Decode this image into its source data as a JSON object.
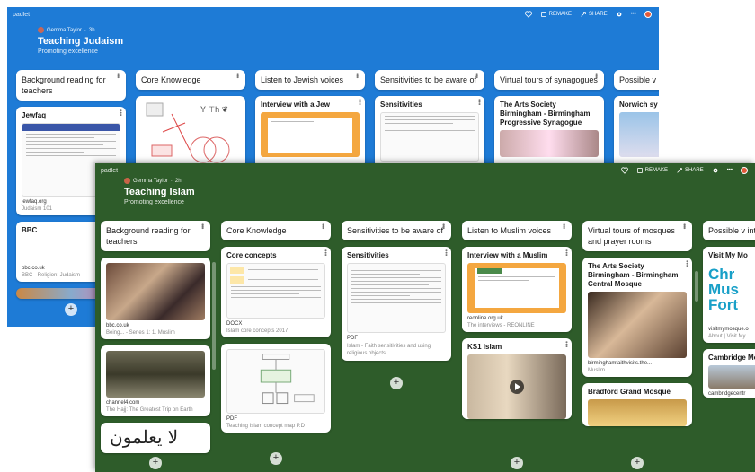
{
  "back_board": {
    "brand": "padlet",
    "author": "Gemma Taylor",
    "age": "3h",
    "title": "Teaching Judaism",
    "subtitle": "Promoting excellence",
    "actions": {
      "remake": "REMAKE",
      "share": "SHARE"
    },
    "columns": [
      {
        "heading": "Background reading for teachers",
        "cards": [
          {
            "title": "Jewfaq",
            "tag": "jewfaq.org",
            "caption": "Judaism 101"
          },
          {
            "title": "BBC",
            "tag": "bbc.co.uk",
            "caption": "BBC - Religion: Judaism"
          }
        ]
      },
      {
        "heading": "Core Knowledge"
      },
      {
        "heading": "Listen to Jewish voices",
        "cards": [
          {
            "title": "Interview with a Jew"
          }
        ]
      },
      {
        "heading": "Sensitivities to be aware of",
        "cards": [
          {
            "title": "Sensitivities"
          }
        ]
      },
      {
        "heading": "Virtual tours of synagogues",
        "cards": [
          {
            "title": "The Arts Society Birmingham - Birmingham Progressive Synagogue"
          }
        ]
      },
      {
        "heading": "Possible v interest to",
        "cards": [
          {
            "title": "Norwich sy"
          }
        ]
      }
    ]
  },
  "front_board": {
    "brand": "padlet",
    "author": "Gemma Taylor",
    "age": "2h",
    "title": "Teaching Islam",
    "subtitle": "Promoting excellence",
    "actions": {
      "remake": "REMAKE",
      "share": "SHARE"
    },
    "columns": [
      {
        "heading": "Background reading for teachers",
        "cards": [
          {
            "tag": "bbc.co.uk",
            "caption": "Being... - Series 1: 1. Muslim"
          },
          {
            "tag": "channel4.com",
            "caption": "The Hajj: The Greatest Trip on Earth"
          }
        ]
      },
      {
        "heading": "Core Knowledge",
        "cards": [
          {
            "title": "Core concepts",
            "badge": "DOCX",
            "caption": "Islam core concepts 2017"
          },
          {
            "badge": "PDF",
            "caption": "Teaching Islam concept map P.D"
          }
        ]
      },
      {
        "heading": "Sensitivities to be aware of",
        "cards": [
          {
            "title": "Sensitivities",
            "badge": "PDF",
            "caption": "Islam - Faith sensitivities and using religious objects"
          }
        ]
      },
      {
        "heading": "Listen to Muslim voices",
        "cards": [
          {
            "title": "Interview with a Muslim",
            "tag": "reonline.org.uk",
            "caption": "The interviews - REONLINE"
          },
          {
            "title": "KS1 Islam"
          }
        ]
      },
      {
        "heading": "Virtual tours of mosques and prayer rooms",
        "cards": [
          {
            "title": "The Arts Society Birmingham - Birmingham Central Mosque",
            "tag": "birminghamfaithvisits.the...",
            "caption": "Muslim"
          },
          {
            "title": "Bradford Grand Mosque"
          }
        ]
      },
      {
        "heading": "Possible v interest to",
        "cards": [
          {
            "title": "Visit My Mo",
            "logo": "Chr Mus Fort",
            "tag": "visitmymosque.o",
            "caption": "About | Visit My"
          },
          {
            "title": "Cambridge Mosque",
            "tag": "cambridgecentr"
          }
        ]
      }
    ]
  },
  "colors": {
    "judaism_bg": "#1e7bd6",
    "islam_bg": "#2e5c2a",
    "card": "#ffffff"
  }
}
